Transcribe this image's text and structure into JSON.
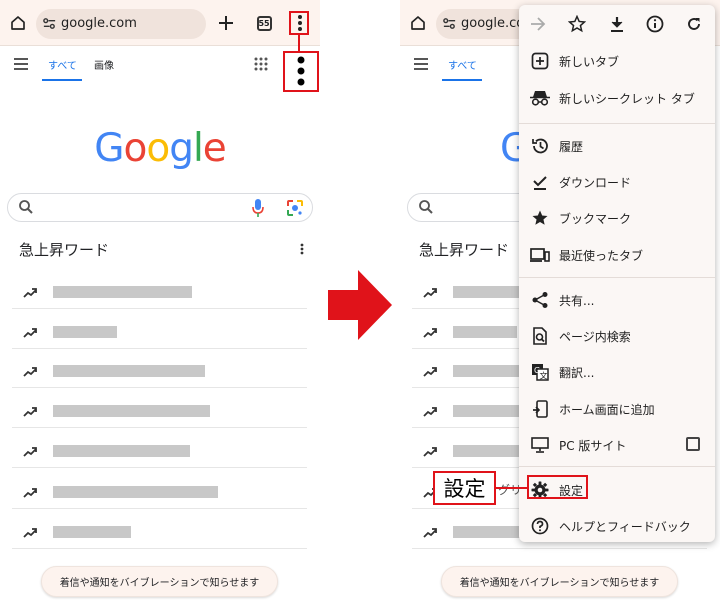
{
  "left": {
    "url": "google.com",
    "tabs_count": "55",
    "nav_tab_all": "すべて",
    "nav_tab_images": "画像",
    "logo": "Google",
    "trending_title": "急上昇ワード",
    "notify_text": "着信や通知をバイブレーションで知らせます"
  },
  "right": {
    "url": "google.com",
    "nav_tab_all": "すべて",
    "logo": "Google",
    "trending_title": "急上昇ワード",
    "notify_text": "着信や通知をバイブレーションで知らせます",
    "partial_text": "グリ"
  },
  "menu": {
    "items": [
      {
        "label": "新しいタブ",
        "icon": "new-tab-icon"
      },
      {
        "label": "新しいシークレット タブ",
        "icon": "incognito-icon"
      },
      {
        "label": "履歴",
        "icon": "history-icon"
      },
      {
        "label": "ダウンロード",
        "icon": "downloads-icon"
      },
      {
        "label": "ブックマーク",
        "icon": "bookmarks-icon"
      },
      {
        "label": "最近使ったタブ",
        "icon": "recent-tabs-icon"
      },
      {
        "label": "共有...",
        "icon": "share-icon"
      },
      {
        "label": "ページ内検索",
        "icon": "find-in-page-icon"
      },
      {
        "label": "翻訳...",
        "icon": "translate-icon"
      },
      {
        "label": "ホーム画面に追加",
        "icon": "add-to-home-icon"
      },
      {
        "label": "PC 版サイト",
        "icon": "desktop-site-icon"
      },
      {
        "label": "設定",
        "icon": "settings-icon"
      },
      {
        "label": "ヘルプとフィードバック",
        "icon": "help-icon"
      }
    ]
  },
  "callout": {
    "label": "設定"
  },
  "colors": {
    "highlight": "#e0131a",
    "google_blue": "#4285f4",
    "google_red": "#ea4335",
    "google_yellow": "#fbbc05",
    "google_green": "#34a853"
  }
}
